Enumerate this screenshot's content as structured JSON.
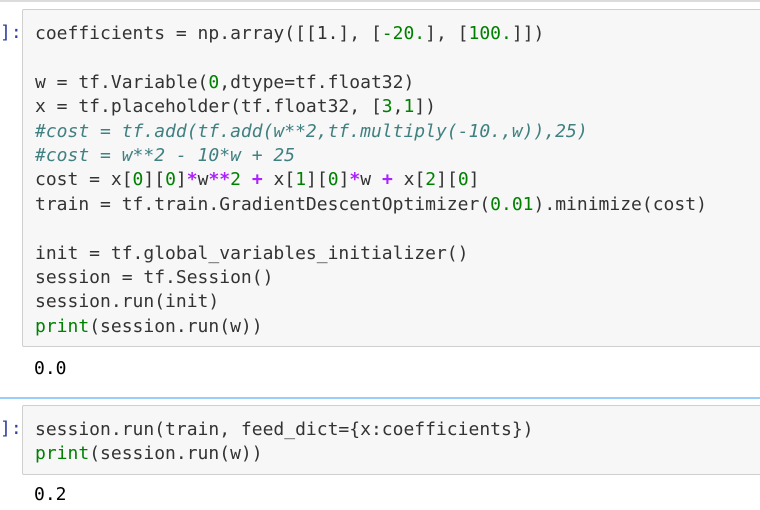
{
  "cells": [
    {
      "prompt": "]:",
      "lines": [
        [
          {
            "t": "tx",
            "v": "coefficients = np.array([[1.], ["
          },
          {
            "t": "num",
            "v": "-20."
          },
          {
            "t": "tx",
            "v": "], ["
          },
          {
            "t": "num",
            "v": "100."
          },
          {
            "t": "tx",
            "v": "]])"
          }
        ],
        [],
        [
          {
            "t": "tx",
            "v": "w = tf.Variable("
          },
          {
            "t": "num",
            "v": "0"
          },
          {
            "t": "tx",
            "v": ",dtype=tf.float32)"
          }
        ],
        [
          {
            "t": "tx",
            "v": "x = tf.placeholder(tf.float32, ["
          },
          {
            "t": "num",
            "v": "3"
          },
          {
            "t": "tx",
            "v": ","
          },
          {
            "t": "num",
            "v": "1"
          },
          {
            "t": "tx",
            "v": "])"
          }
        ],
        [
          {
            "t": "cm",
            "v": "#cost = tf.add(tf.add(w**2,tf.multiply(-10.,w)),25)"
          }
        ],
        [
          {
            "t": "cm",
            "v": "#cost = w**2 - 10*w + 25"
          }
        ],
        [
          {
            "t": "tx",
            "v": "cost = x["
          },
          {
            "t": "num",
            "v": "0"
          },
          {
            "t": "tx",
            "v": "]["
          },
          {
            "t": "num",
            "v": "0"
          },
          {
            "t": "tx",
            "v": "]"
          },
          {
            "t": "op",
            "v": "*"
          },
          {
            "t": "tx",
            "v": "w"
          },
          {
            "t": "op",
            "v": "**"
          },
          {
            "t": "num",
            "v": "2"
          },
          {
            "t": "tx",
            "v": " "
          },
          {
            "t": "op",
            "v": "+"
          },
          {
            "t": "tx",
            "v": " x["
          },
          {
            "t": "num",
            "v": "1"
          },
          {
            "t": "tx",
            "v": "]["
          },
          {
            "t": "num",
            "v": "0"
          },
          {
            "t": "tx",
            "v": "]"
          },
          {
            "t": "op",
            "v": "*"
          },
          {
            "t": "tx",
            "v": "w "
          },
          {
            "t": "op",
            "v": "+"
          },
          {
            "t": "tx",
            "v": " x["
          },
          {
            "t": "num",
            "v": "2"
          },
          {
            "t": "tx",
            "v": "]["
          },
          {
            "t": "num",
            "v": "0"
          },
          {
            "t": "tx",
            "v": "]"
          }
        ],
        [
          {
            "t": "tx",
            "v": "train = tf.train.GradientDescentOptimizer("
          },
          {
            "t": "num",
            "v": "0.01"
          },
          {
            "t": "tx",
            "v": ").minimize(cost)"
          }
        ],
        [],
        [
          {
            "t": "tx",
            "v": "init = tf.global_variables_initializer()"
          }
        ],
        [
          {
            "t": "tx",
            "v": "session = tf.Session()"
          }
        ],
        [
          {
            "t": "tx",
            "v": "session.run(init)"
          }
        ],
        [
          {
            "t": "nm",
            "v": "print"
          },
          {
            "t": "tx",
            "v": "(session.run(w))"
          }
        ]
      ],
      "output": "0.0"
    },
    {
      "prompt": "]:",
      "lines": [
        [
          {
            "t": "tx",
            "v": "session.run(train, feed_dict={x:coefficients})"
          }
        ],
        [
          {
            "t": "nm",
            "v": "print"
          },
          {
            "t": "tx",
            "v": "(session.run(w))"
          }
        ]
      ],
      "output": "0.2"
    }
  ]
}
